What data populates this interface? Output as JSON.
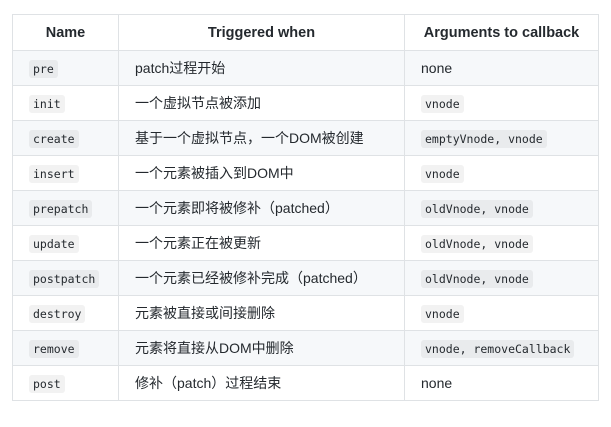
{
  "table": {
    "headers": [
      "Name",
      "Triggered when",
      "Arguments to callback"
    ],
    "rows": [
      {
        "name": "pre",
        "desc": "patch过程开始",
        "args": "none",
        "args_code": false
      },
      {
        "name": "init",
        "desc": "一个虚拟节点被添加",
        "args": "vnode",
        "args_code": true
      },
      {
        "name": "create",
        "desc": "基于一个虚拟节点，一个DOM被创建",
        "args": "emptyVnode, vnode",
        "args_code": true
      },
      {
        "name": "insert",
        "desc": "一个元素被插入到DOM中",
        "args": "vnode",
        "args_code": true
      },
      {
        "name": "prepatch",
        "desc": "一个元素即将被修补（patched）",
        "args": "oldVnode, vnode",
        "args_code": true
      },
      {
        "name": "update",
        "desc": "一个元素正在被更新",
        "args": "oldVnode, vnode",
        "args_code": true
      },
      {
        "name": "postpatch",
        "desc": "一个元素已经被修补完成（patched）",
        "args": "oldVnode, vnode",
        "args_code": true
      },
      {
        "name": "destroy",
        "desc": "元素被直接或间接删除",
        "args": "vnode",
        "args_code": true
      },
      {
        "name": "remove",
        "desc": "元素将直接从DOM中删除",
        "args": "vnode, removeCallback",
        "args_code": true
      },
      {
        "name": "post",
        "desc": "修补（patch）过程结束",
        "args": "none",
        "args_code": false
      }
    ]
  }
}
